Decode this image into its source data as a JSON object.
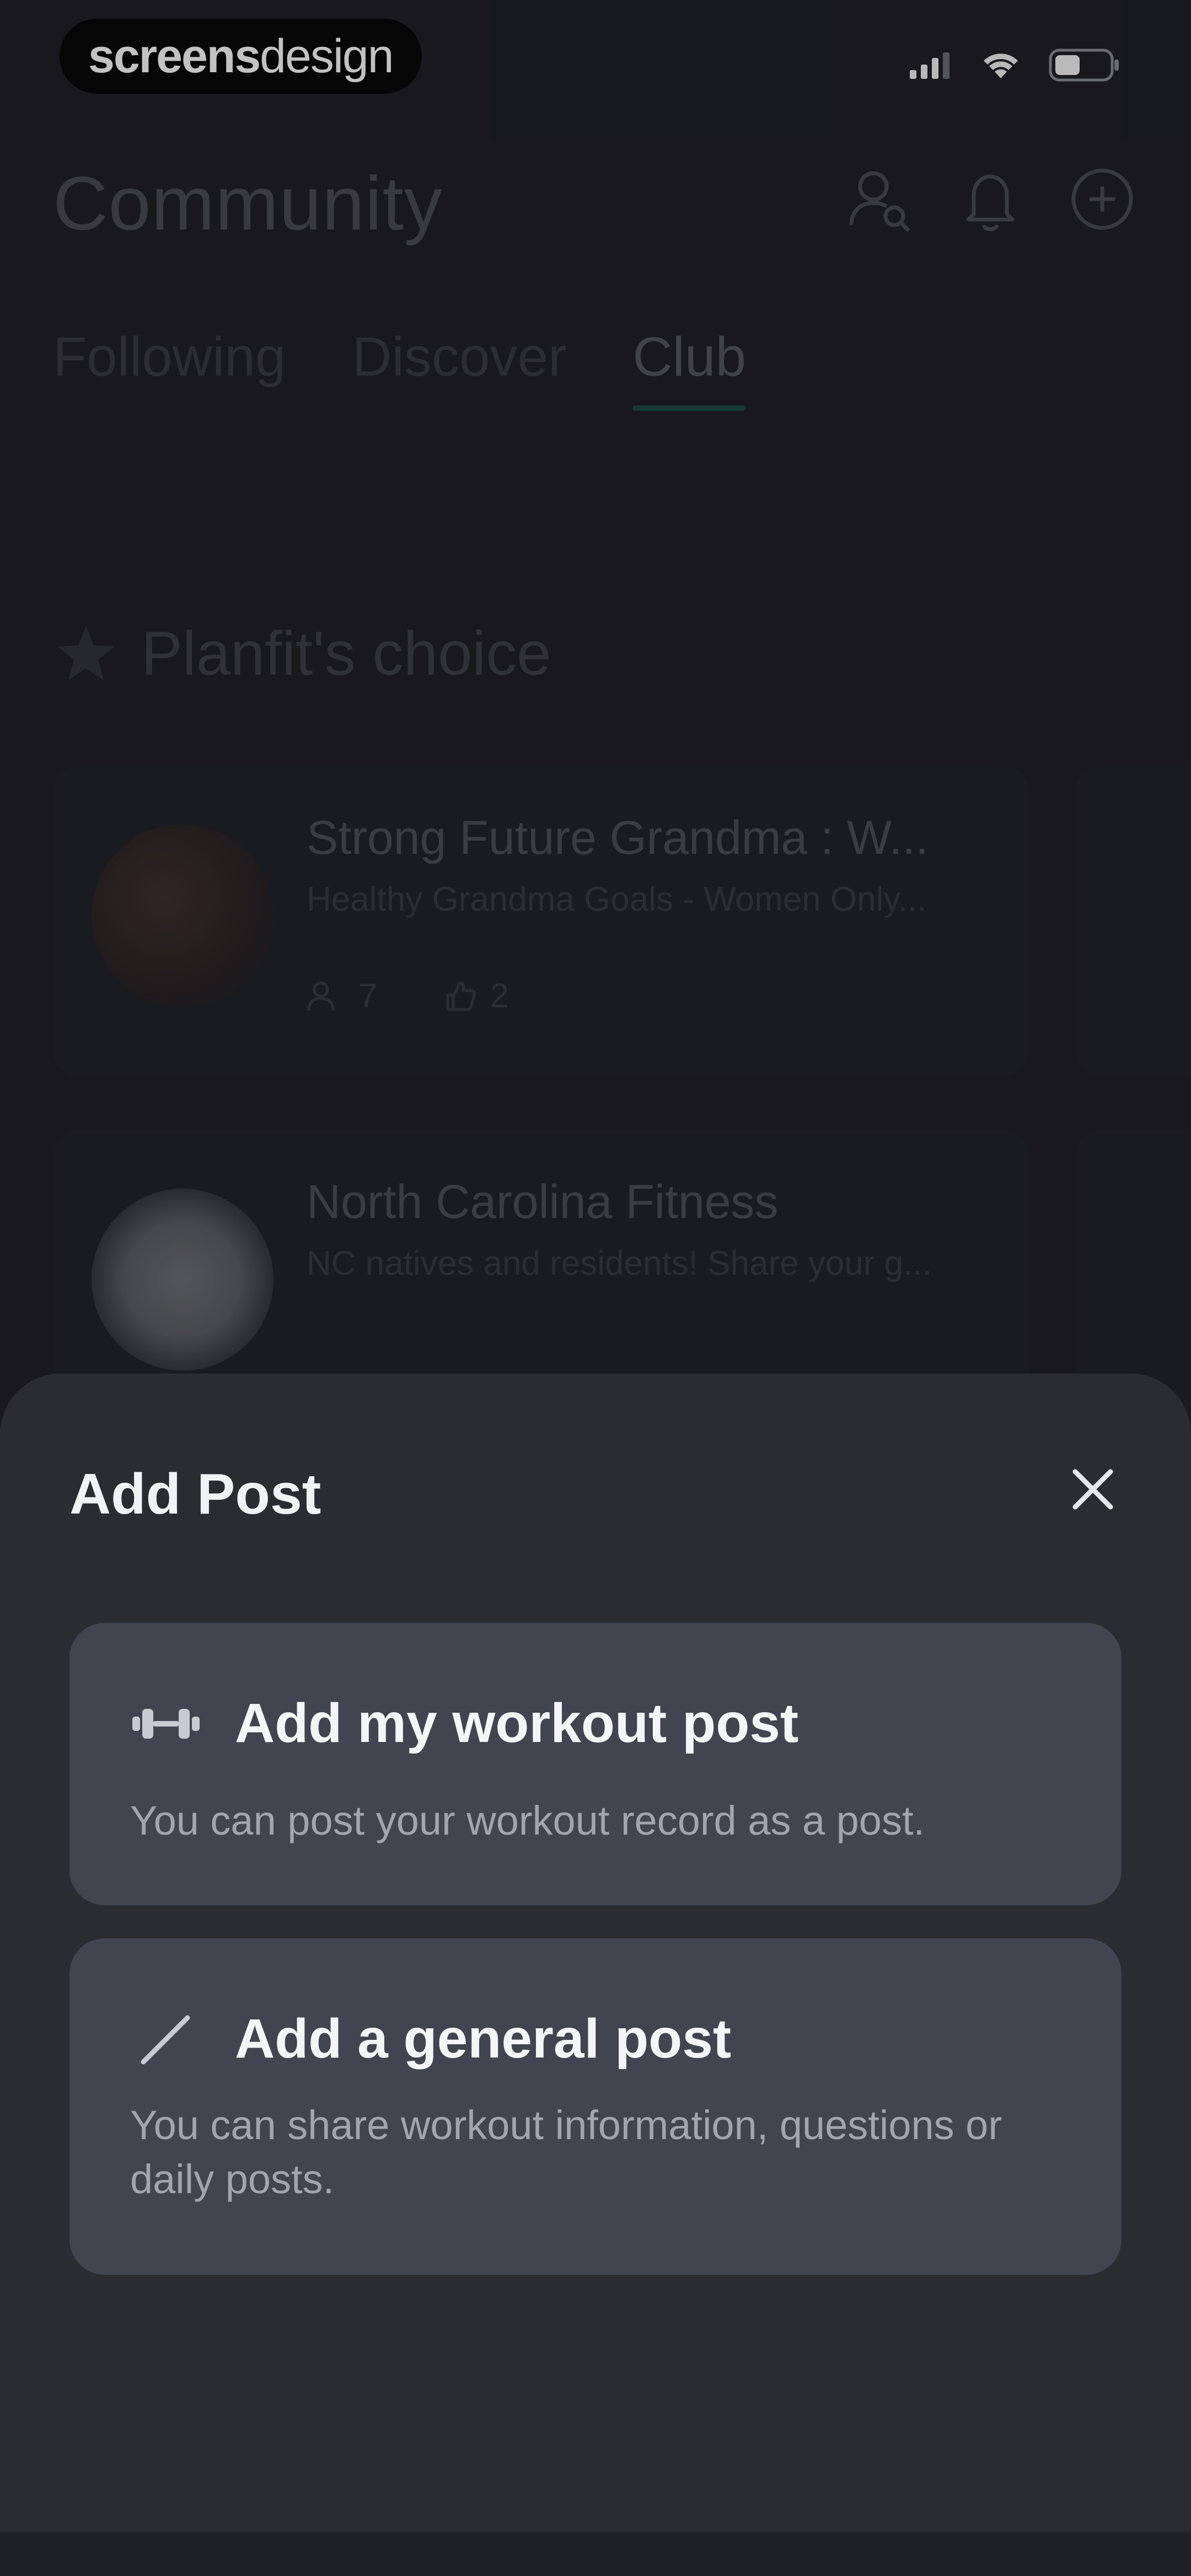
{
  "status_bar": {
    "brand_part1": "screens",
    "brand_part2": "design"
  },
  "header": {
    "title": "Community",
    "actions": [
      {
        "icon": "find-user-icon"
      },
      {
        "icon": "bell-icon"
      },
      {
        "icon": "add-circle-icon"
      }
    ]
  },
  "tabs": [
    {
      "label": "Following",
      "active": false
    },
    {
      "label": "Discover",
      "active": false
    },
    {
      "label": "Club",
      "active": true
    }
  ],
  "section": {
    "title": "Planfit's choice",
    "icon": "star-icon"
  },
  "clubs": [
    {
      "name": "Strong Future Grandma : W...",
      "description": "Healthy Grandma Goals - Women Only...",
      "members": "7",
      "posts": "2"
    },
    {
      "name": "North Carolina Fitness",
      "description": "NC natives and residents! Share your g..."
    }
  ],
  "sheet": {
    "title": "Add Post",
    "close_icon": "close-icon",
    "options": [
      {
        "icon": "dumbbell-icon",
        "title": "Add my workout post",
        "description": "You can post your workout record as a post."
      },
      {
        "icon": "pencil-icon",
        "title": "Add a general post",
        "description": "You can share workout information, questions or daily posts."
      }
    ]
  },
  "colors": {
    "background": "#1c1d22",
    "sheet": "#2a2c32",
    "option_card": "#42444f",
    "accent": "#0f8f6a"
  }
}
